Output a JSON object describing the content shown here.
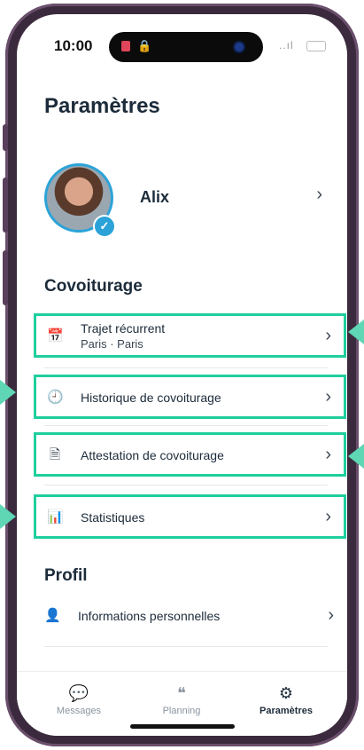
{
  "status_bar": {
    "time": "10:00",
    "signal": "..ıl"
  },
  "page": {
    "title": "Paramètres"
  },
  "profile": {
    "name": "Alix",
    "chevron": "›"
  },
  "covoiturage": {
    "title": "Covoiturage",
    "items": [
      {
        "label": "Trajet récurrent",
        "sub": "Paris · Paris",
        "icon": "calendar-clock-icon",
        "chevron": "›"
      },
      {
        "label": "Historique de covoiturage",
        "icon": "clock-icon",
        "chevron": "›"
      },
      {
        "label": "Attestation de covoiturage",
        "icon": "document-icon",
        "chevron": "›"
      },
      {
        "label": "Statistiques",
        "icon": "bar-chart-icon",
        "chevron": "›"
      }
    ]
  },
  "profil": {
    "title": "Profil",
    "items": [
      {
        "label": "Informations personnelles",
        "icon": "person-icon",
        "chevron": "›"
      }
    ]
  },
  "tabbar": {
    "tabs": [
      {
        "label": "Messages",
        "icon": "chat-icon",
        "active": false
      },
      {
        "label": "Planning",
        "icon": "planning-icon",
        "active": false
      },
      {
        "label": "Paramètres",
        "icon": "gear-icon",
        "active": true
      }
    ]
  },
  "colors": {
    "highlight": "#1fcf9e",
    "accent": "#2ba3d8",
    "text": "#1c2b3a",
    "frame": "#3b2a3d"
  }
}
